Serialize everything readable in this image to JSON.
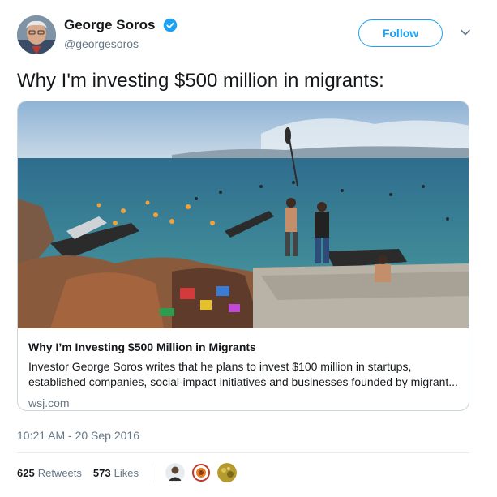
{
  "user": {
    "display_name": "George Soros",
    "handle": "@georgesoros",
    "verified": true,
    "avatar_icon": "profile-photo-avatar"
  },
  "follow_label": "Follow",
  "tweet_text": "Why I'm investing $500 million in migrants:",
  "card": {
    "title": "Why I’m Investing $500 Million in Migrants",
    "description_lines": [
      "Investor George Soros writes that he plans to invest $100 million in startups,",
      "established companies, social-impact initiatives and businesses founded by migrant..."
    ],
    "domain": "wsj.com",
    "image_icon": "migrants-boats-coast-photo"
  },
  "timestamp": "10:21 AM - 20 Sep 2016",
  "stats": {
    "retweets_count": "625",
    "retweets_label": "Retweets",
    "likes_count": "573",
    "likes_label": "Likes"
  },
  "colors": {
    "accent": "#1da1f2",
    "secondary_text": "#657786",
    "border": "#ccd6dd"
  }
}
